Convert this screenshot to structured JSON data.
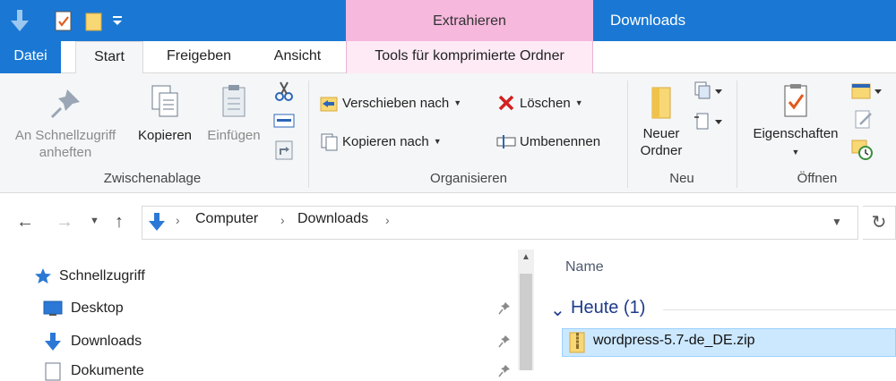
{
  "window": {
    "title": "Downloads"
  },
  "contextual": {
    "band_label": "Extrahieren",
    "tab_label": "Tools für komprimierte Ordner"
  },
  "tabs": [
    "Datei",
    "Start",
    "Freigeben",
    "Ansicht"
  ],
  "ribbon": {
    "clipboard": {
      "pin_line1": "An Schnellzugriff",
      "pin_line2": "anheften",
      "copy": "Kopieren",
      "paste": "Einfügen",
      "label": "Zwischenablage"
    },
    "organize": {
      "move_to": "Verschieben nach",
      "copy_to": "Kopieren nach",
      "delete": "Löschen",
      "rename": "Umbenennen",
      "label": "Organisieren"
    },
    "new": {
      "folder_line1": "Neuer",
      "folder_line2": "Ordner",
      "label": "Neu"
    },
    "open": {
      "properties": "Eigenschaften",
      "label": "Öffnen"
    }
  },
  "address": {
    "crumbs": [
      "Computer",
      "Downloads"
    ]
  },
  "nav": {
    "items": [
      "Schnellzugriff",
      "Desktop",
      "Downloads",
      "Dokumente"
    ]
  },
  "files": {
    "column_name": "Name",
    "group": "Heute (1)",
    "items": [
      "wordpress-5.7-de_DE.zip"
    ]
  },
  "colors": {
    "accent": "#1a78d4",
    "contextual": "#f6b8dc",
    "selection": "#cce8ff"
  }
}
